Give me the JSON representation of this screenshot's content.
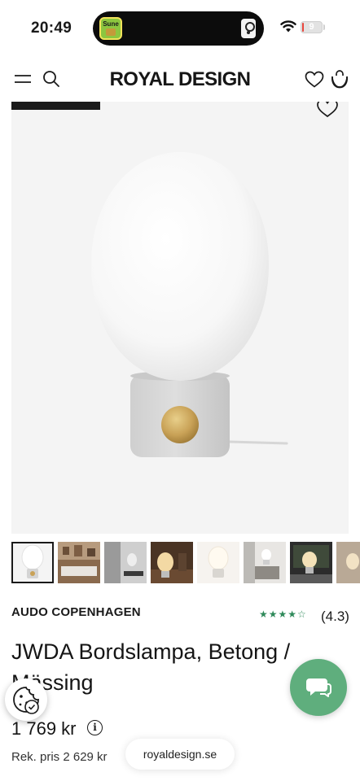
{
  "status_bar": {
    "time": "20:49",
    "island_app_label": "Sune",
    "battery": "9",
    "battery_level": 0.09
  },
  "header": {
    "brand": "ROYAL DESIGN",
    "menu_icon": "hamburger-icon",
    "search_icon": "search-icon",
    "wishlist_icon": "heart-icon",
    "cart_icon": "shopping-bag-icon"
  },
  "gallery": {
    "thumbnail_count": 8,
    "selected_index": 0,
    "wishlist_icon": "heart-icon"
  },
  "product": {
    "brand": "AUDO COPENHAGEN",
    "stars": "★★★★☆",
    "rating": "(4.3)",
    "title": "JWDA Bordslampa, Betong / Mässing",
    "price": "1 769 kr",
    "info_icon_label": "i",
    "original_price": "Rek. pris 2 629 kr"
  },
  "overlays": {
    "url": "royaldesign.se",
    "cookie_icon": "cookie-icon",
    "chat_icon": "chat-icon"
  },
  "colors": {
    "accent_green": "#5fae7d",
    "rating_green": "#2f8a5a",
    "text": "#1a1a1a"
  }
}
